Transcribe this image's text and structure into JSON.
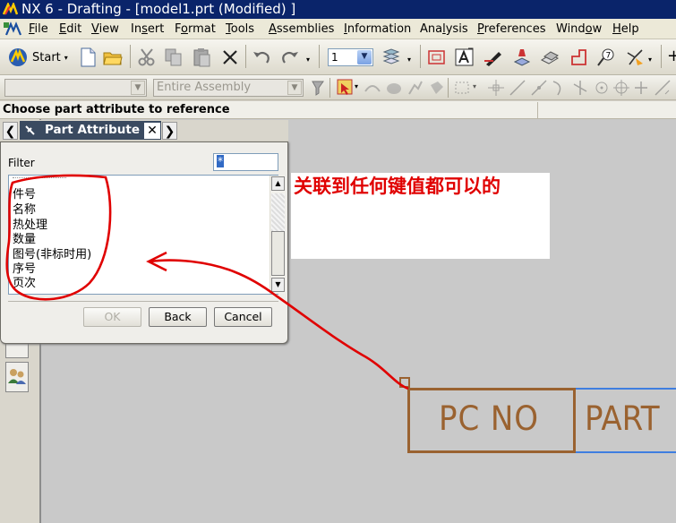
{
  "window": {
    "title": "NX 6 - Drafting - [model1.prt (Modified) ]"
  },
  "menu": [
    {
      "label": "File",
      "ul": "F"
    },
    {
      "label": "Edit",
      "ul": "E"
    },
    {
      "label": "View",
      "ul": "V"
    },
    {
      "label": "Insert",
      "ul": "s"
    },
    {
      "label": "Format",
      "ul": "o"
    },
    {
      "label": "Tools",
      "ul": "T"
    },
    {
      "label": "Assemblies",
      "ul": "A"
    },
    {
      "label": "Information",
      "ul": "I"
    },
    {
      "label": "Analysis",
      "ul": "l"
    },
    {
      "label": "Preferences",
      "ul": "P"
    },
    {
      "label": "Window",
      "ul": "o"
    },
    {
      "label": "Help",
      "ul": "H"
    }
  ],
  "toolbar": {
    "start_label": "Start",
    "layer_value": "1"
  },
  "selection_bar": {
    "filter_value": "",
    "scope_value": "Entire Assembly"
  },
  "cue_line": "Choose part attribute to reference",
  "dialog": {
    "title": "Part Attribute",
    "filter_label": "Filter",
    "filter_value": "*",
    "items": [
      "件号",
      "名称",
      "热处理",
      "数量",
      "图号(非标时用)",
      "序号",
      "页次"
    ],
    "ok_label": "OK",
    "back_label": "Back",
    "cancel_label": "Cancel"
  },
  "annotation": "关联到任何键值都可以的",
  "drawing": {
    "cell1": "PC NO",
    "cell2": "PART"
  },
  "colors": {
    "annotation": "#e00000",
    "drawing_text": "#9a6230",
    "title_bar": "#0a246a"
  }
}
